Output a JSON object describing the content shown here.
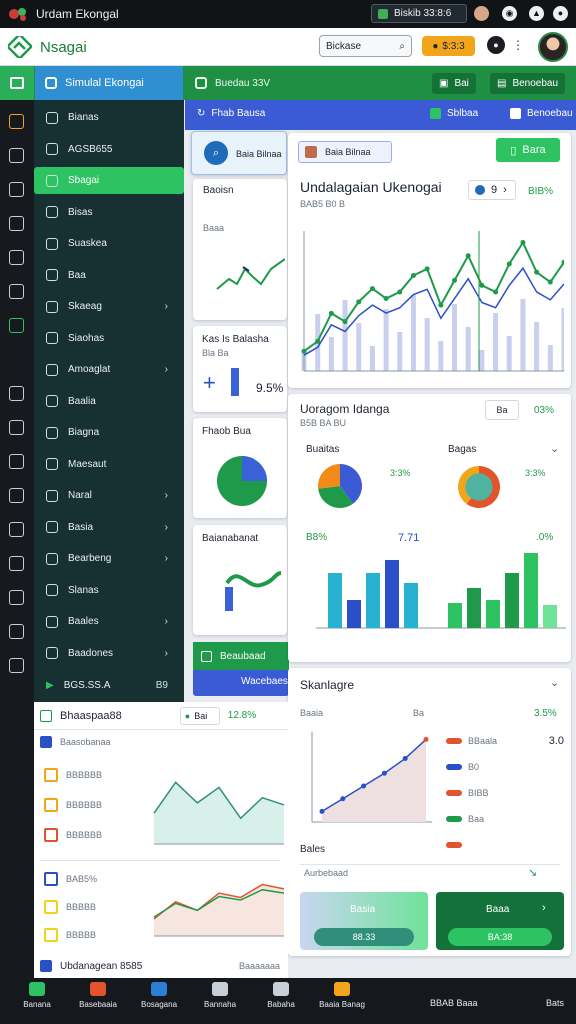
{
  "status_bar": {
    "app_title": "Urdam Ekongal",
    "pill_text": "Biskib 33:8:6"
  },
  "header": {
    "brand": "Nsagai",
    "search_text": "Bickase",
    "orange_text": "$:3:3"
  },
  "strip": {
    "tab1": "Simulal Ekongai",
    "tab2": "Buedau 33V",
    "btn1": "Bai",
    "btn2": "Benoebau"
  },
  "sidebar": {
    "items": [
      {
        "label": "Bianas",
        "chevron": false
      },
      {
        "label": "AGSB655",
        "chevron": false
      },
      {
        "label": "Sbagai",
        "chevron": false,
        "active": true
      },
      {
        "label": "Bisas",
        "chevron": false
      },
      {
        "label": "Suaskea",
        "chevron": false
      },
      {
        "label": "Baa",
        "chevron": false
      },
      {
        "label": "Skaeag",
        "chevron": true
      },
      {
        "label": "Siaohas",
        "chevron": false
      },
      {
        "label": "Amoaglat",
        "chevron": true
      },
      {
        "label": "Baalia",
        "chevron": false
      },
      {
        "label": "Biagna",
        "chevron": false
      },
      {
        "label": "Maesaut",
        "chevron": false
      },
      {
        "label": "Naral",
        "chevron": true
      },
      {
        "label": "Basia",
        "chevron": true
      },
      {
        "label": "Bearbeng",
        "chevron": true
      },
      {
        "label": "Slanas",
        "chevron": false
      },
      {
        "label": "Baales",
        "chevron": true
      },
      {
        "label": "Baadones",
        "chevron": true
      }
    ],
    "footer": "BGS.SS.A",
    "footer_right": "B9"
  },
  "bluebar": {
    "title": "Fhab Bausa",
    "right": "Sblbaa"
  },
  "main_title": "Undalagaian Ukenogai",
  "main_sub": "BAB5 B0 B",
  "main_btn": "Bara",
  "search_chip": "Baia Bilnaa",
  "main_badge1": "9",
  "main_badge2": "BIB%",
  "donut_title": "Uoragom Idanga",
  "donut_sub": "B5B BA BU",
  "donut_badge1": "Ba",
  "donut_badge2": "03%",
  "donut1_label": "Buaitas",
  "donut2_label": "Bagas",
  "donut1_pct": "3:3%",
  "donut2_pct": "3:3%",
  "bar_label_left": "B8%",
  "bar_label_mid": "7.71",
  "bar_label_right": ".0%",
  "left_cards": {
    "c1_title": "Baoisn",
    "c1_sub": "Baaa",
    "c2_title": "Kas Is Balasha",
    "c2_sub": "Bla Ba",
    "c2_value": "9.5%",
    "c3_title": "Fhaob Bua",
    "c4_title": "Baianabanat",
    "c5_title": "Beaubaad",
    "c5_btn": "Wacebaes"
  },
  "right_cards": {
    "c6_title": "Skanlagre",
    "c6_sub": "Baaia",
    "c6_list_title": "Bales",
    "c6_footer": "Aurbebaad",
    "btn_left": "Basia",
    "btn_left_val": "88.33",
    "btn_right": "Baaa",
    "btn_right_val": "BA:38"
  },
  "bottom_left": {
    "header": "Bhaaspaa88",
    "header_badge": "Bai",
    "header_pct": "12.8%",
    "sub": "Baasobanaa",
    "rows": [
      "BBBBBB",
      "BBBBBB",
      "BBBBBB"
    ],
    "rows2": [
      "BAB5%",
      "BBBBB",
      "BBBBB"
    ],
    "footer": "Ubdanagean 8585",
    "footer_right": "Baaaaaaa"
  },
  "right_list": {
    "items": [
      "Ba",
      "BBaala",
      "B0",
      "BIBB",
      "Baa"
    ],
    "pct": "3.5%",
    "val": "3.0"
  },
  "nav": {
    "items": [
      "Banana",
      "Basebaaia",
      "Bosagana",
      "Bannaha",
      "Babaha",
      "Baaia Banag"
    ],
    "right_text": "BBAB Baaa",
    "clock": "Bats"
  },
  "chart_data": [
    {
      "type": "line",
      "series": [
        {
          "values": [
            12,
            18,
            35,
            30,
            42,
            50,
            44,
            48,
            58,
            62,
            40,
            55,
            70,
            52,
            48,
            65,
            78,
            60,
            54,
            66
          ]
        }
      ]
    },
    {
      "type": "pie",
      "series": [
        {
          "values": [
            40,
            33,
            27
          ]
        }
      ]
    },
    {
      "type": "pie",
      "series": [
        {
          "values": [
            60,
            40
          ]
        }
      ]
    },
    {
      "type": "bar",
      "series": [
        {
          "values": [
            55,
            28,
            55,
            68,
            45
          ]
        },
        {
          "values": [
            25,
            40,
            28,
            55,
            75,
            23
          ]
        }
      ]
    },
    {
      "type": "line",
      "series": [
        {
          "values": [
            10,
            22,
            34,
            46,
            60,
            78
          ]
        }
      ]
    },
    {
      "type": "area",
      "series": [
        {
          "values": [
            30,
            60,
            40,
            55,
            25,
            45,
            38
          ]
        }
      ]
    },
    {
      "type": "line",
      "series": [
        {
          "values": [
            20,
            40,
            30,
            50,
            45,
            60,
            55
          ]
        }
      ]
    }
  ]
}
